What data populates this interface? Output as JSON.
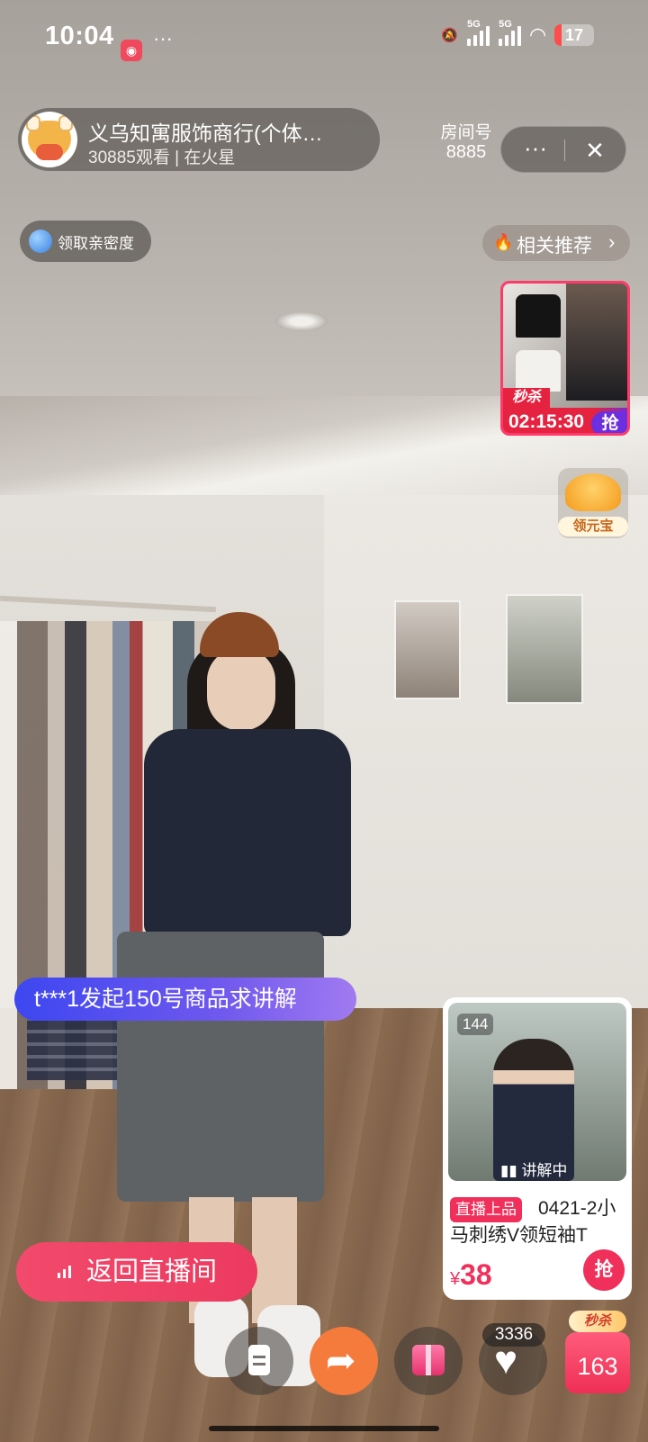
{
  "status_bar": {
    "time": "10:04",
    "more": "···",
    "network_1": "5G",
    "network_2": "5G",
    "battery": "17"
  },
  "header": {
    "host_name": "义乌知寓服饰商行(个体…",
    "viewers": "30885观看 | 在火星",
    "room_label": "房间号",
    "room_number": "8885",
    "more_icon": "···",
    "close_icon": "✕"
  },
  "intimacy": {
    "label": "领取亲密度"
  },
  "related": {
    "label": "相关推荐",
    "chevron": "›"
  },
  "flash_sale": {
    "tag": "秒杀",
    "countdown": "02:15:30",
    "grab": "抢"
  },
  "yuanbao": {
    "label": "领元宝"
  },
  "request_banner": {
    "text": "t***1发起150号商品求讲解"
  },
  "product": {
    "index": "144",
    "explaining": "讲解中",
    "live_tag": "直播上品",
    "title": "0421-2小马刺绣V领短袖T",
    "currency": "¥",
    "price": "38",
    "buy": "抢"
  },
  "return_button": {
    "label": "返回直播间"
  },
  "toolbar": {
    "like_count": "3336",
    "seckill_badge": "秒杀",
    "cart_count": "163"
  },
  "colors": {
    "accent": "#f0305b",
    "share": "#f57b3d",
    "banner_start": "#3d47f0",
    "banner_end": "#a07af0"
  }
}
